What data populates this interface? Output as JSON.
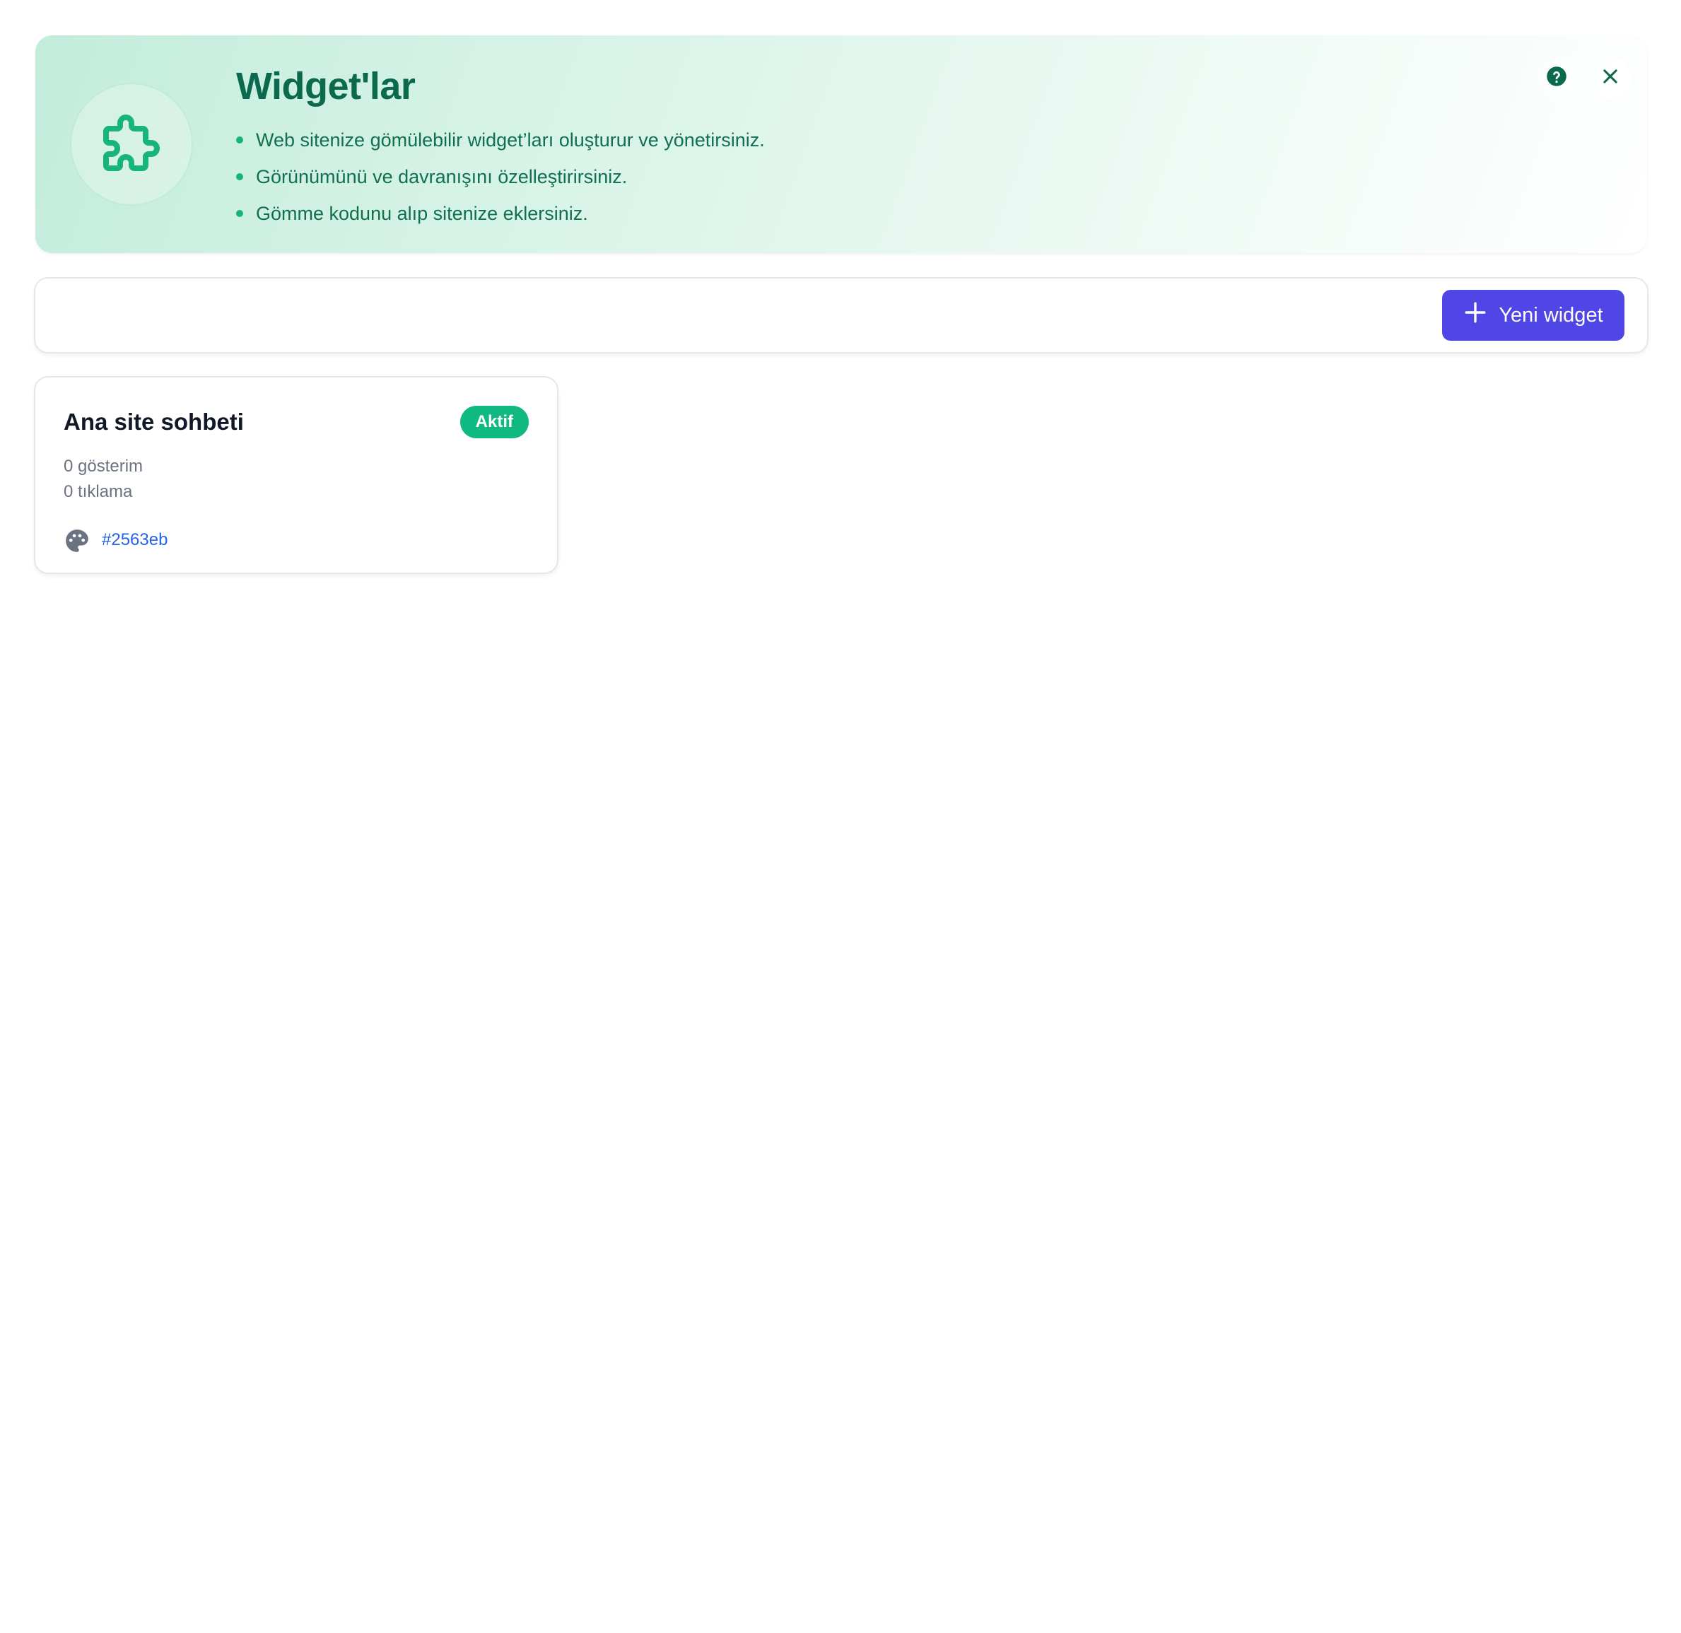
{
  "hero": {
    "title": "Widget'lar",
    "bullets": [
      "Web sitenize gömülebilir widget’ları oluşturur ve yönetirsiniz.",
      "Görünümünü ve davranışını özelleştirirsiniz.",
      "Gömme kodunu alıp sitenize eklersiniz."
    ],
    "icon": "puzzle-icon",
    "help_icon": "question-circle-icon",
    "close_icon": "close-icon"
  },
  "toolbar": {
    "new_button_label": "Yeni widget",
    "new_button_icon": "plus-icon"
  },
  "widgets": [
    {
      "name": "Ana site sohbeti",
      "status": "Aktif",
      "views": "0 gösterim",
      "clicks": "0 tıklama",
      "color": "#2563eb",
      "color_icon": "palette-icon"
    }
  ],
  "colors": {
    "hero_title": "#0b6a4d",
    "hero_text": "#11704f",
    "accent_green": "#10b981",
    "primary_button": "#4f46e5",
    "link_blue": "#2563eb",
    "muted_text": "#6b7280"
  }
}
